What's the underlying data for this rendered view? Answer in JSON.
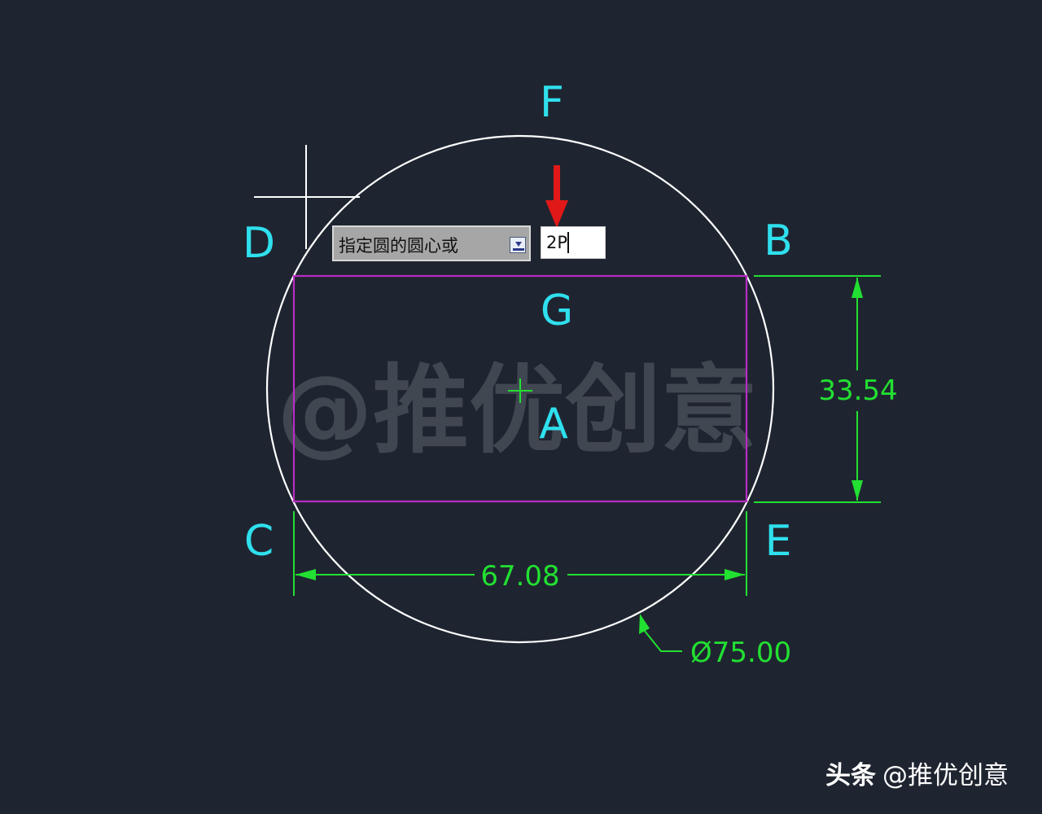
{
  "labels": {
    "F": "F",
    "D": "D",
    "B": "B",
    "G": "G",
    "A": "A",
    "C": "C",
    "E": "E"
  },
  "dimensions": {
    "height": "33.54",
    "width": "67.08",
    "diameter": "Ø75.00"
  },
  "prompt": {
    "text": "指定圆的圆心或",
    "input_value": "2P",
    "dropdown_icon": "dropdown-arrow-icon"
  },
  "watermark": "@推优创意",
  "credit": {
    "platform": "头条",
    "author": "@推优创意"
  },
  "colors": {
    "background": "#1f2530",
    "circle": "#ffffff",
    "rectangle": "#b82cc4",
    "dimension": "#22e032",
    "label": "#2fe0ee",
    "pointer_arrow": "#e01818"
  }
}
